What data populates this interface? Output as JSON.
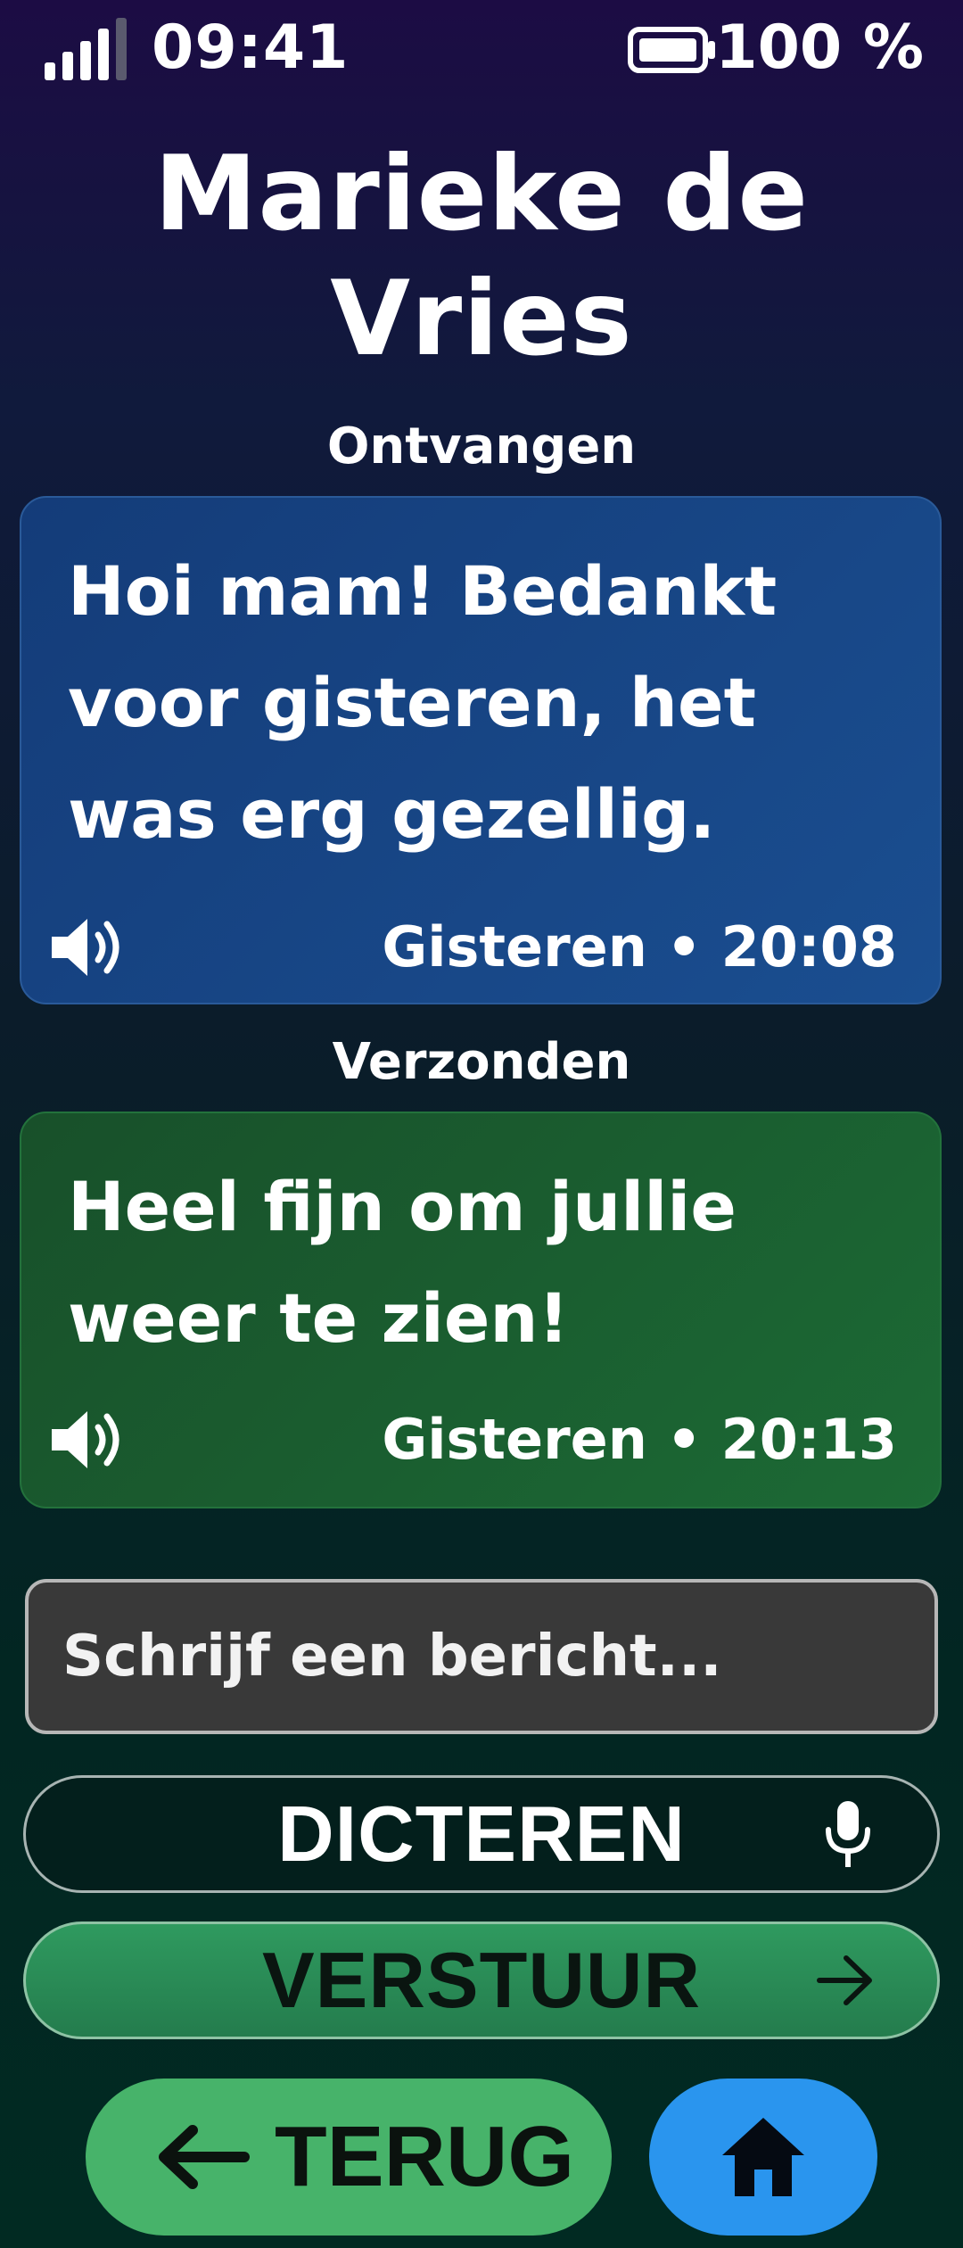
{
  "status_bar": {
    "time": "09:41",
    "battery": "100 %",
    "icons": [
      "signal-icon",
      "battery-icon"
    ]
  },
  "contact": {
    "name": "Marieke de Vries"
  },
  "messages": {
    "received": {
      "label": "Ontvangen",
      "text": "Hoi mam! Bedankt voor gisteren, het was erg gezellig.",
      "meta": "Gisteren • 20:08",
      "icon": "speaker-icon",
      "color": "#1a4a8c"
    },
    "sent": {
      "label": "Verzonden",
      "text": "Heel fijn om jullie weer te zien!",
      "meta": "Gisteren • 20:13",
      "icon": "speaker-icon",
      "color": "#1c6432"
    }
  },
  "composer": {
    "placeholder": "Schrijf een bericht...",
    "value": ""
  },
  "buttons": {
    "dictate": "DICTEREN",
    "send": "VERSTUUR",
    "back": "TERUG",
    "home_icon": "home-icon"
  },
  "colors": {
    "back_button": "#47b36a",
    "home_button": "#2a95ee",
    "send_button": "#2a8c56"
  }
}
